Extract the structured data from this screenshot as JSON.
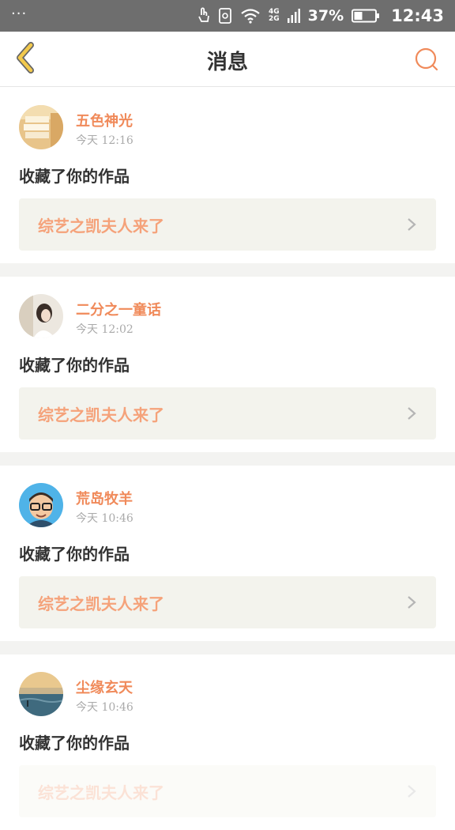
{
  "status_bar": {
    "dots": "···",
    "network_top": "4G",
    "network_bottom": "2G",
    "battery_percent": "37%",
    "time": "12:43"
  },
  "header": {
    "title": "消息",
    "back_icon": "chevron-left-icon",
    "search_icon": "search-icon"
  },
  "colors": {
    "accent": "#f08a5a",
    "back_arrow": "#f2c94c",
    "link_bg": "#f3f3ed"
  },
  "messages": [
    {
      "name": "五色神光",
      "time": "今天 12:16",
      "action": "收藏了你的作品",
      "work": "综艺之凯夫人来了"
    },
    {
      "name": "二分之一童话",
      "time": "今天 12:02",
      "action": "收藏了你的作品",
      "work": "综艺之凯夫人来了"
    },
    {
      "name": "荒岛牧羊",
      "time": "今天 10:46",
      "action": "收藏了你的作品",
      "work": "综艺之凯夫人来了"
    },
    {
      "name": "尘缘玄天",
      "time": "今天 10:46",
      "action": "收藏了你的作品",
      "work": "综艺之凯夫人来了"
    }
  ]
}
